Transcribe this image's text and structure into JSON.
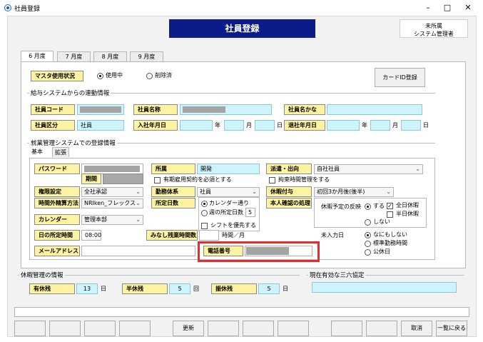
{
  "window": {
    "title": "社員登録",
    "minimize": "–",
    "maximize": "□",
    "close": "✕"
  },
  "header": {
    "title": "社員登録",
    "user_line1": "未所属",
    "user_line2": "システム管理者"
  },
  "tabs": [
    "6 月度",
    "7 月度",
    "8 月度",
    "9 月度"
  ],
  "master": {
    "label": "マスタ使用状況",
    "opt1": "使用中",
    "opt2": "削除済",
    "card_button": "カードID登録"
  },
  "payroll": {
    "section": "給与システムからの連動情報",
    "emp_code": "社員コード",
    "emp_name": "社員名称",
    "emp_kana": "社員名かな",
    "emp_kubun": "社員区分",
    "emp_kubun_val": "社員",
    "join_date": "入社年月日",
    "leave_date": "退社年月日",
    "y": "年",
    "m": "月",
    "d": "日"
  },
  "system": {
    "section": "就業管理システムでの登録情報",
    "subtab1": "基本",
    "subtab2": "拡張",
    "password": "パスワード",
    "period": "期間",
    "dept": "所属",
    "dept_val": "開発",
    "contract_check": "有期雇用契約を必須とする",
    "haken": "派遣・出向",
    "haken_val": "自社社員",
    "kosoku_check": "拘束時間管理をする",
    "kengen": "権限設定",
    "kengen_val": "全社承認",
    "kinmu": "勤務体系",
    "kinmu_val": "社員",
    "kyuka": "休暇付与",
    "kyuka_val": "初回3か月後(後半)",
    "seisan": "時間外精算方法",
    "seisan_val": "NRIken_フレックス",
    "shotei": "所定日数",
    "calendar_opt": "カレンダー通り",
    "week_opt": "週の所定日数",
    "week_val": "5",
    "shift_check": "シフトを優先する",
    "honnin": "本人確認の処理",
    "yotei": "休暇予定の反映",
    "suru": "する",
    "shinai": "しない",
    "zenjitsu": "全日休暇",
    "hanjitsu": "半日休暇",
    "calendar": "カレンダー",
    "calendar_val": "管理本部",
    "day_time": "日の所定時間",
    "day_time_val": "08:00",
    "minashi": "みなし残業時間数",
    "month_unit": "時間／月",
    "mikomi": "未入力日",
    "nashi": "なにもしない",
    "hyojun": "標準勤務時間",
    "kokyu": "公休日",
    "mail": "メールアドレス",
    "tel": "電話番号"
  },
  "leave": {
    "section": "休暇管理の情報",
    "yukyu": "有休残",
    "yukyu_val": "13",
    "day_unit": "日",
    "hankyu": "半休残",
    "hankyu_val": "5",
    "kai_unit": "回",
    "furikyu": "振休残",
    "furikyu_val": "5"
  },
  "sanroku": {
    "section": "現在有効な三六協定"
  },
  "footer": {
    "update": "更新",
    "cancel": "取消",
    "back": "一覧に戻る"
  }
}
